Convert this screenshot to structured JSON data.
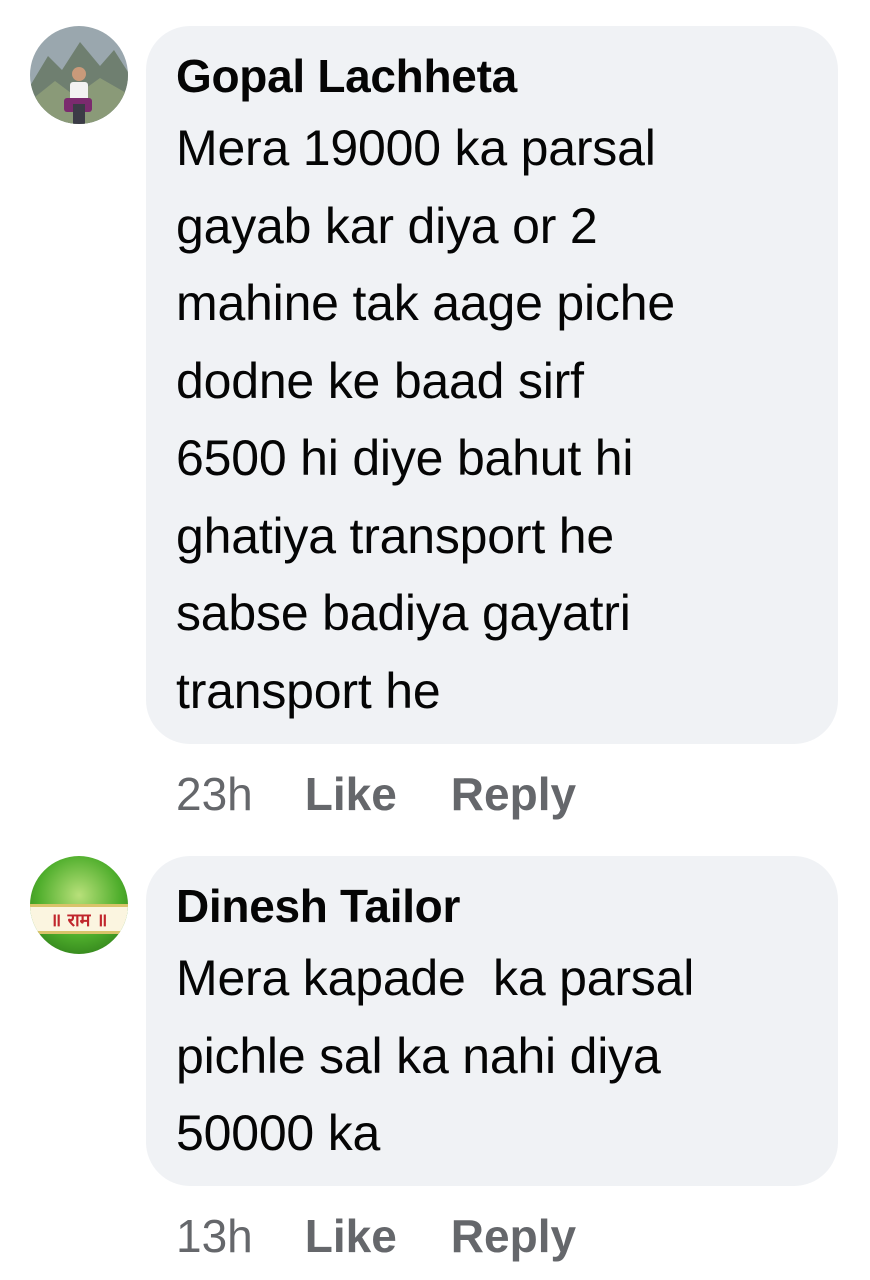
{
  "comments": [
    {
      "author": "Gopal Lachheta",
      "text": "Mera 19000 ka parsal\ngayab kar diya or 2\nmahine tak aage piche\ndodne ke baad sirf\n6500 hi diye bahut hi\nghatiya transport he\nsabse badiya gayatri\ntransport he",
      "time": "23h",
      "like_label": "Like",
      "reply_label": "Reply",
      "avatar_icon": "profile-photo-mountains"
    },
    {
      "author": "Dinesh Tailor",
      "text": "Mera kapade  ka parsal\npichle sal ka nahi diya\n50000 ka",
      "time": "13h",
      "like_label": "Like",
      "reply_label": "Reply",
      "avatar_icon": "profile-photo-green-banner",
      "avatar_banner_text": "॥ राम ॥"
    }
  ],
  "colors": {
    "bubble": "#f0f2f5",
    "text": "#050505",
    "meta": "#65676b"
  }
}
